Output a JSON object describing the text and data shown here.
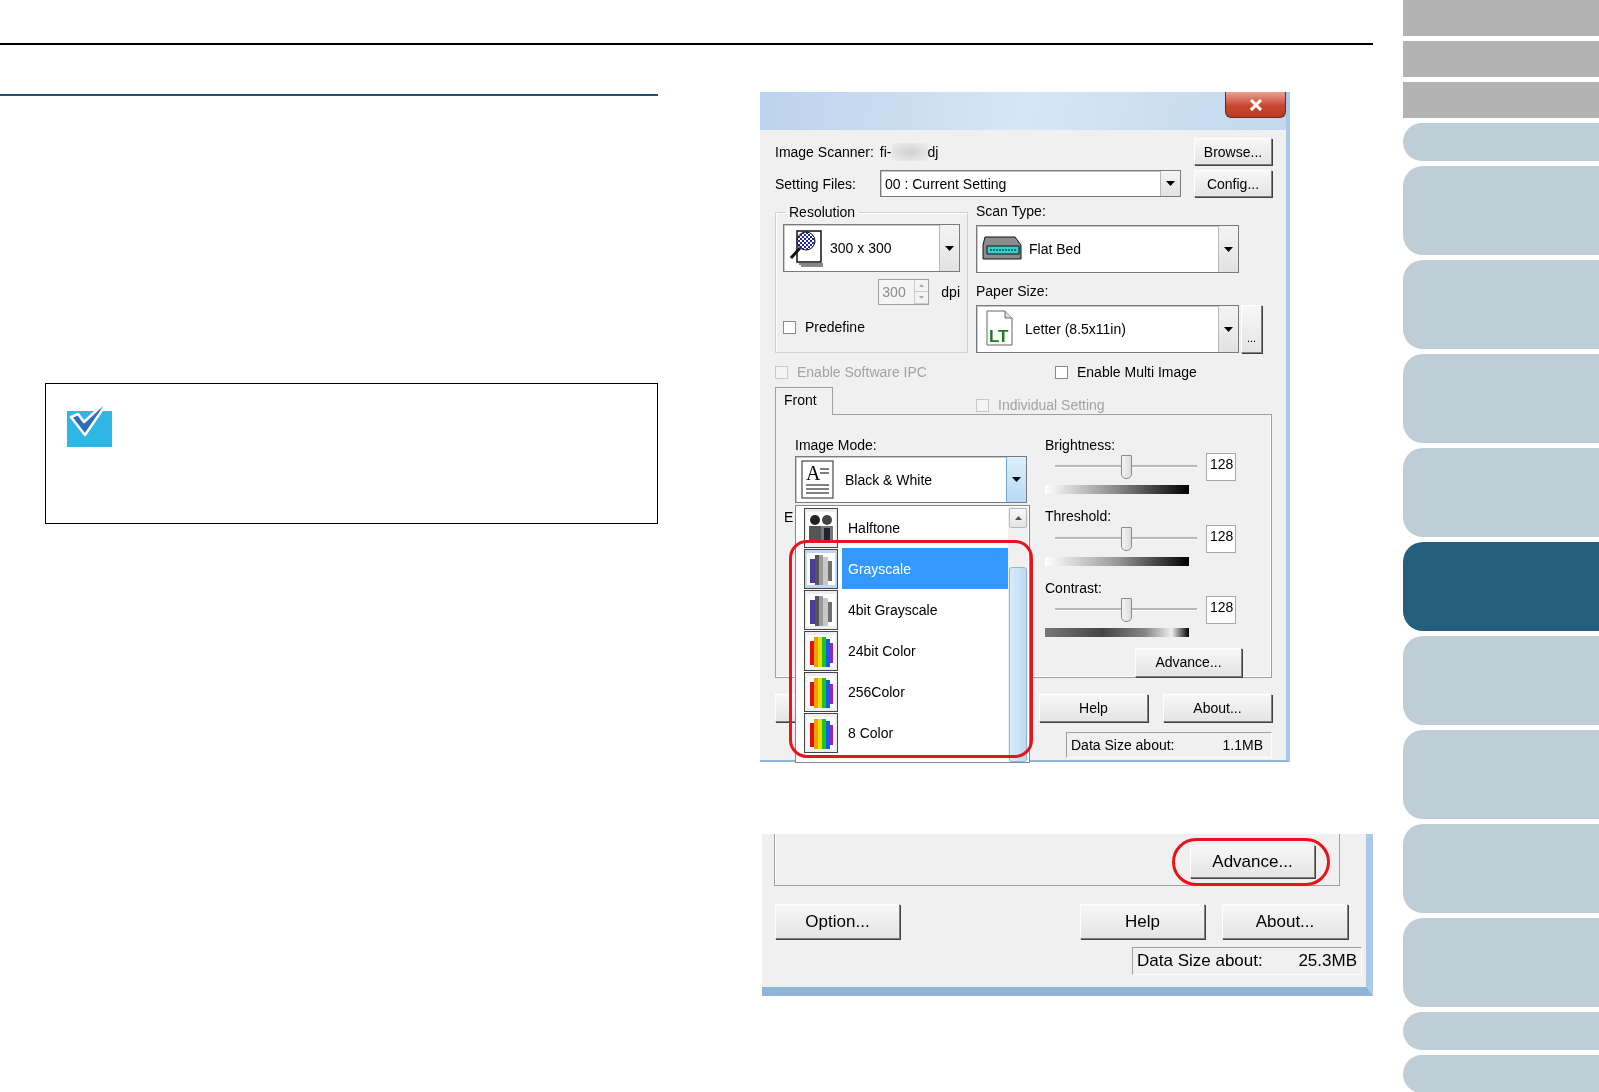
{
  "dialog": {
    "image_scanner": {
      "label": "Image Scanner:",
      "value_start": "fi-",
      "value_end": "dj"
    },
    "browse_button": "Browse...",
    "setting_files": {
      "label": "Setting Files:",
      "value": "00 : Current Setting"
    },
    "config_button": "Config...",
    "resolution": {
      "label": "Resolution",
      "value": "300 x 300",
      "dpi": "300",
      "unit": "dpi"
    },
    "predefine": {
      "label": "Predefine",
      "checked": false
    },
    "scan_type": {
      "label": "Scan Type:",
      "value": "Flat Bed"
    },
    "paper_size": {
      "label": "Paper Size:",
      "value": "Letter (8.5x11in)",
      "icon_text": "LT",
      "more_button": "..."
    },
    "options": [
      {
        "label": "Enable Software IPC",
        "checked": false,
        "disabled": true
      },
      {
        "label": "Enable Multi Image",
        "checked": false,
        "disabled": false
      }
    ],
    "tabs": [
      {
        "label": "Front",
        "selected": true
      }
    ],
    "individual_setting": {
      "label": "Individual Setting",
      "checked": false,
      "disabled": true
    },
    "image_mode": {
      "label": "Image Mode:",
      "value": "Black & White",
      "icon_text": "A",
      "expanded": true,
      "covered_label": "E",
      "items": [
        {
          "label": "Halftone",
          "kind": "halftone",
          "selected": false
        },
        {
          "label": "Grayscale",
          "kind": "grayscale",
          "selected": true
        },
        {
          "label": "4bit Grayscale",
          "kind": "grayscale",
          "selected": false
        },
        {
          "label": "24bit Color",
          "kind": "color",
          "selected": false
        },
        {
          "label": "256Color",
          "kind": "color",
          "selected": false
        },
        {
          "label": "8 Color",
          "kind": "color",
          "selected": false
        }
      ]
    },
    "adjustments": [
      {
        "label": "Brightness:",
        "value": "128",
        "level": 0.5
      },
      {
        "label": "Threshold:",
        "value": "128",
        "level": 0.5
      },
      {
        "label": "Contrast:",
        "value": "128",
        "level": 0.5
      }
    ],
    "advance_button": "Advance...",
    "buttons": [
      "Help",
      "About..."
    ],
    "status": {
      "label": "Data Size about:",
      "value": "1.1MB"
    }
  },
  "detail": {
    "advance_button": "Advance...",
    "buttons": [
      "Option...",
      "Help",
      "About..."
    ],
    "status": {
      "label": "Data Size about:",
      "value": "25.3MB"
    }
  },
  "side_tabs": [
    {
      "kind": "header",
      "selected": false
    },
    {
      "kind": "header",
      "selected": false
    },
    {
      "kind": "header",
      "selected": false
    },
    {
      "kind": "short",
      "selected": false
    },
    {
      "kind": "tall",
      "selected": false
    },
    {
      "kind": "tall",
      "selected": false
    },
    {
      "kind": "tall",
      "selected": false
    },
    {
      "kind": "tall",
      "selected": false
    },
    {
      "kind": "tall",
      "selected": true
    },
    {
      "kind": "tall",
      "selected": false
    },
    {
      "kind": "tall",
      "selected": false
    },
    {
      "kind": "tall",
      "selected": false
    },
    {
      "kind": "tall",
      "selected": false
    },
    {
      "kind": "short",
      "selected": false
    },
    {
      "kind": "short",
      "selected": false
    }
  ]
}
